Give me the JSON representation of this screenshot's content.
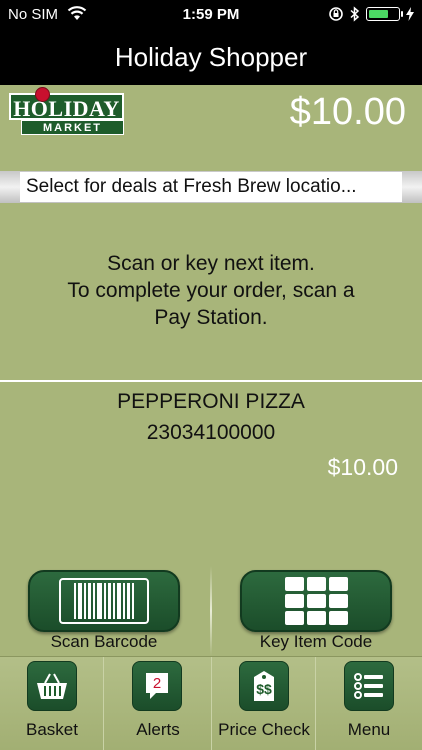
{
  "status_bar": {
    "carrier": "No SIM",
    "time": "1:59 PM",
    "icons": [
      "wifi-icon",
      "rotation-lock-icon",
      "bluetooth-icon",
      "battery-icon",
      "charging-icon"
    ]
  },
  "nav": {
    "title": "Holiday Shopper"
  },
  "header": {
    "logo_top": "HOLIDAY",
    "logo_bottom": "MARKET",
    "total": "$10.00"
  },
  "deals": {
    "label": "Select for deals at Fresh Brew locatio..."
  },
  "message": {
    "line1": "Scan or key next item.",
    "line2": "To complete your order, scan a",
    "line3": "Pay Station."
  },
  "item": {
    "name": "PEPPERONI PIZZA",
    "code": "23034100000",
    "price": "$10.00"
  },
  "actions": {
    "scan_label": "Scan Barcode",
    "key_label": "Key Item Code"
  },
  "tabs": [
    {
      "label": "Basket",
      "icon": "basket-icon"
    },
    {
      "label": "Alerts",
      "icon": "alerts-icon",
      "badge": "2"
    },
    {
      "label": "Price Check",
      "icon": "price-tag-icon"
    },
    {
      "label": "Menu",
      "icon": "menu-icon"
    }
  ],
  "colors": {
    "background": "#a8b57a",
    "button_green": "#1e5c2b",
    "accent_red": "#c8102e"
  }
}
